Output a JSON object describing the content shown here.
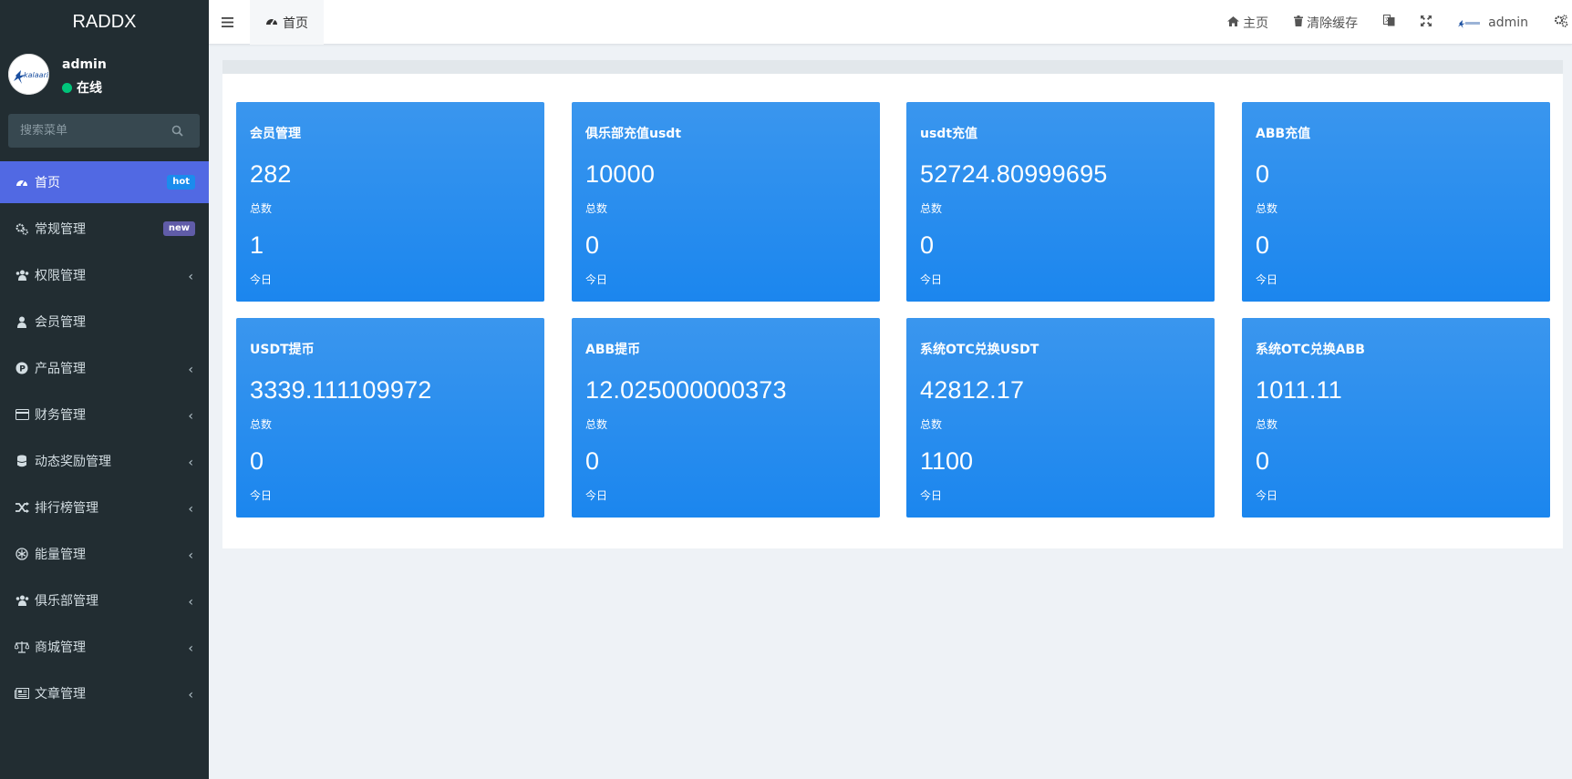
{
  "sidebar": {
    "brand": "RADDX",
    "user": {
      "name": "admin",
      "status": "在线",
      "avatar_logo_text": "kalaari"
    },
    "search": {
      "placeholder": "搜索菜单"
    },
    "items": [
      {
        "label": "首页",
        "icon": "dashboard-icon",
        "badge": "hot",
        "active": true
      },
      {
        "label": "常规管理",
        "icon": "cogs-icon",
        "badge": "new"
      },
      {
        "label": "权限管理",
        "icon": "group-icon",
        "chevron": true
      },
      {
        "label": "会员管理",
        "icon": "user-icon"
      },
      {
        "label": "产品管理",
        "icon": "product-p-icon",
        "chevron": true
      },
      {
        "label": "财务管理",
        "icon": "credit-card-icon",
        "chevron": true
      },
      {
        "label": "动态奖励管理",
        "icon": "database-icon",
        "chevron": true
      },
      {
        "label": "排行榜管理",
        "icon": "random-icon",
        "chevron": true
      },
      {
        "label": "能量管理",
        "icon": "snowflake-icon",
        "chevron": true
      },
      {
        "label": "俱乐部管理",
        "icon": "group-icon",
        "chevron": true
      },
      {
        "label": "商城管理",
        "icon": "balance-scale-icon",
        "chevron": true
      },
      {
        "label": "文章管理",
        "icon": "newspaper-icon",
        "chevron": true
      }
    ]
  },
  "navbar": {
    "tab_home": "首页",
    "links": {
      "home": "主页",
      "clear_cache": "清除缓存",
      "admin": "admin"
    }
  },
  "cards": [
    {
      "title": "会员管理",
      "total": "282",
      "total_label": "总数",
      "today": "1",
      "today_label": "今日"
    },
    {
      "title": "俱乐部充值usdt",
      "total": "10000",
      "total_label": "总数",
      "today": "0",
      "today_label": "今日"
    },
    {
      "title": "usdt充值",
      "total": "52724.80999695",
      "total_label": "总数",
      "today": "0",
      "today_label": "今日"
    },
    {
      "title": "ABB充值",
      "total": "0",
      "total_label": "总数",
      "today": "0",
      "today_label": "今日"
    },
    {
      "title": "USDT提币",
      "total": "3339.111109972",
      "total_label": "总数",
      "today": "0",
      "today_label": "今日"
    },
    {
      "title": "ABB提币",
      "total": "12.025000000373",
      "total_label": "总数",
      "today": "0",
      "today_label": "今日"
    },
    {
      "title": "系统OTC兑换USDT",
      "total": "42812.17",
      "total_label": "总数",
      "today": "1100",
      "today_label": "今日"
    },
    {
      "title": "系统OTC兑换ABB",
      "total": "1011.11",
      "total_label": "总数",
      "today": "0",
      "today_label": "今日"
    }
  ],
  "colors": {
    "sidebar_bg": "#222d32",
    "active_menu": "#5169e3",
    "card_blue": "#1b86ee",
    "hot_badge": "#1b8ced",
    "new_badge": "#605ca8",
    "online": "#00c47a"
  }
}
